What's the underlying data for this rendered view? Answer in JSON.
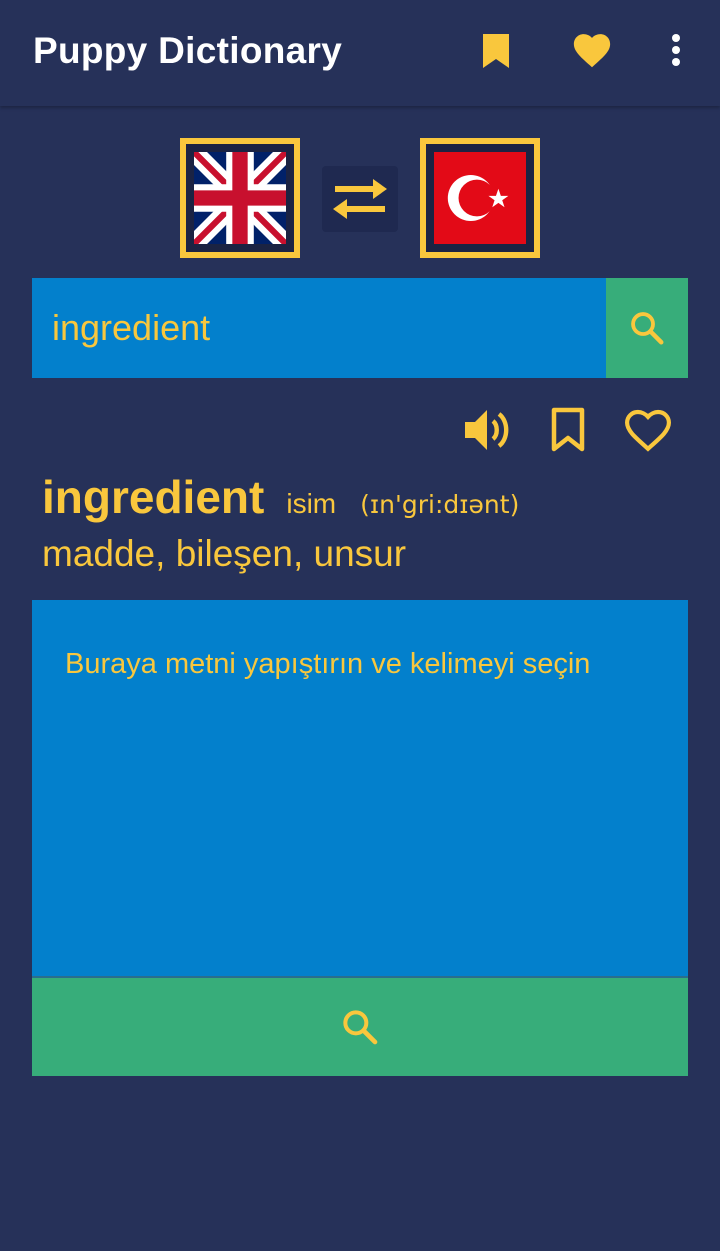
{
  "app": {
    "title": "Puppy Dictionary"
  },
  "icons": {
    "bookmarks": "bookmark-icon",
    "favorites": "heart-icon",
    "menu": "more-vert-icon",
    "swap": "swap-arrows-icon",
    "search": "search-icon",
    "pronounce": "speaker-icon"
  },
  "languages": {
    "source": "English (UK flag)",
    "target": "Turkish (TR flag)"
  },
  "search": {
    "value": "ingredient"
  },
  "result": {
    "word": "ingredient",
    "part_of_speech": "isim",
    "pronunciation": "(ɪn'gri:dɪənt)",
    "meaning": "madde, bileşen, unsur"
  },
  "text_area": {
    "placeholder": "Buraya metni yapıştırın ve kelimeyi seçin"
  },
  "colors": {
    "background": "#263159",
    "accent": "#f9c73d",
    "input_blue": "#0380cc",
    "button_green": "#37ad7a"
  }
}
